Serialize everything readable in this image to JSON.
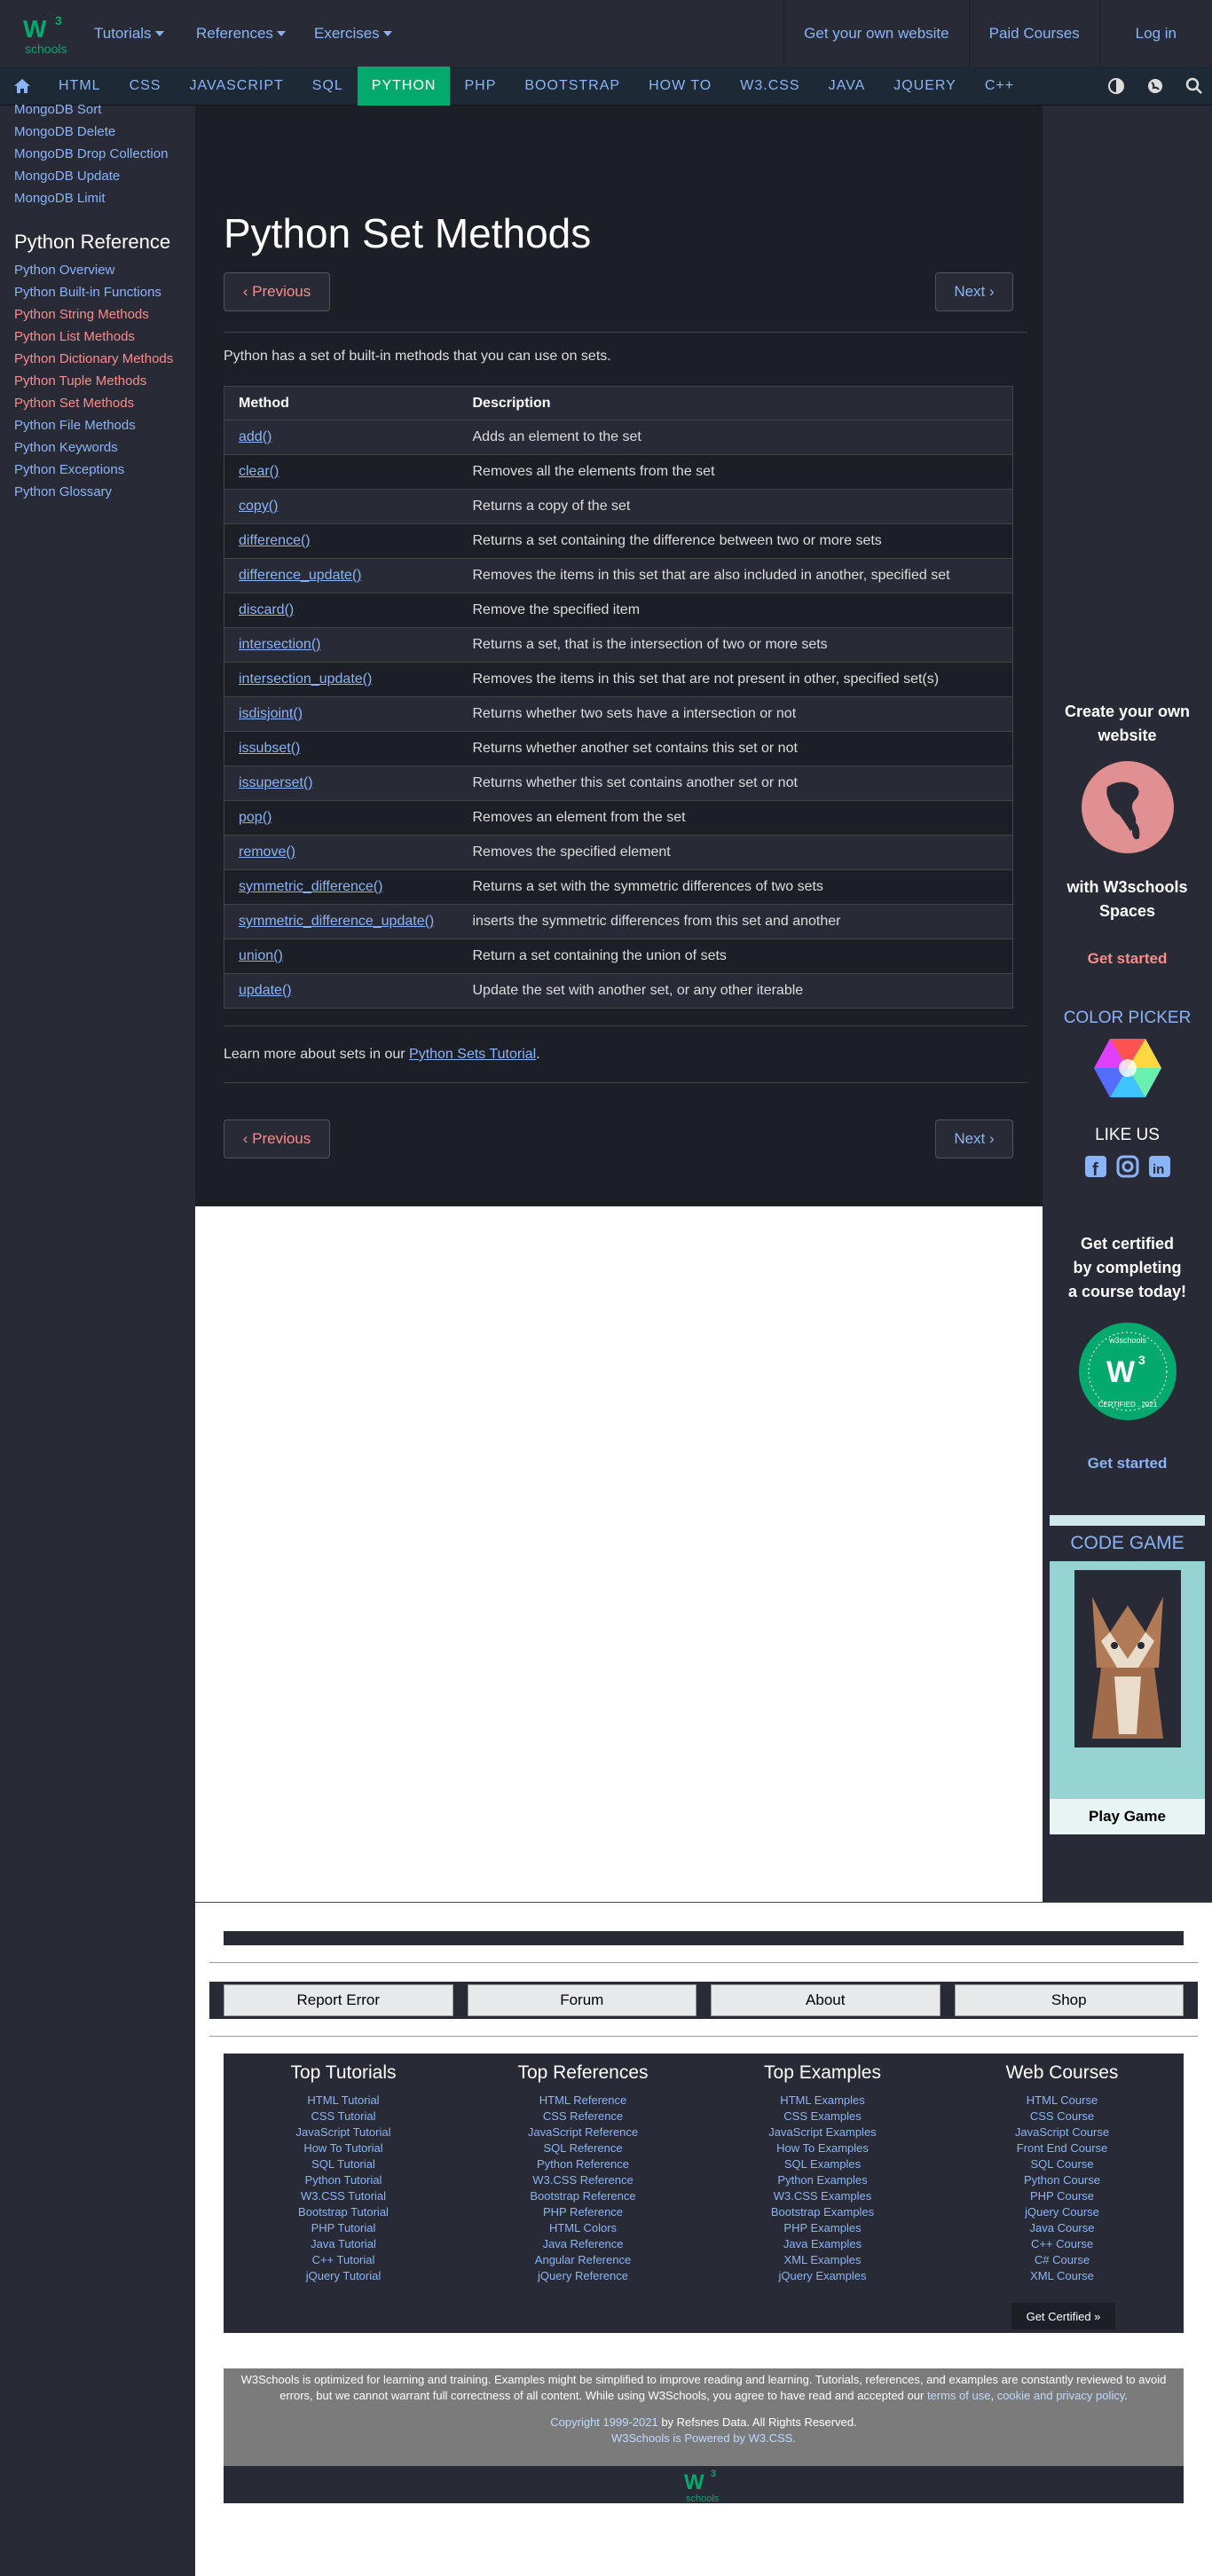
{
  "brand": {
    "name": "schools",
    "superscript": "3",
    "accent": "#04aa6d"
  },
  "topnav": {
    "tutorials": "Tutorials",
    "references": "References",
    "exercises": "Exercises"
  },
  "topright": {
    "website": "Get your own website",
    "courses": "Paid Courses",
    "login": "Log in"
  },
  "navbar": [
    "HTML",
    "CSS",
    "JAVASCRIPT",
    "SQL",
    "PYTHON",
    "PHP",
    "BOOTSTRAP",
    "HOW TO",
    "W3.CSS",
    "JAVA",
    "JQUERY",
    "C++"
  ],
  "sidebar": {
    "mongo": [
      "MongoDB Sort",
      "MongoDB Delete",
      "MongoDB Drop Collection",
      "MongoDB Update",
      "MongoDB Limit"
    ],
    "ref_title": "Python Reference",
    "refs": [
      {
        "label": "Python Overview",
        "color": "blue"
      },
      {
        "label": "Python Built-in Functions",
        "color": "blue"
      },
      {
        "label": "Python String Methods",
        "color": "red"
      },
      {
        "label": "Python List Methods",
        "color": "red"
      },
      {
        "label": "Python Dictionary Methods",
        "color": "red"
      },
      {
        "label": "Python Tuple Methods",
        "color": "red"
      },
      {
        "label": "Python Set Methods",
        "color": "red"
      },
      {
        "label": "Python File Methods",
        "color": "blue"
      },
      {
        "label": "Python Keywords",
        "color": "blue"
      },
      {
        "label": "Python Exceptions",
        "color": "blue"
      },
      {
        "label": "Python Glossary",
        "color": "blue"
      }
    ]
  },
  "main": {
    "title": "Python Set Methods",
    "prev": "Previous",
    "next": "Next",
    "intro": "Python has a set of built-in methods that you can use on sets.",
    "headers": [
      "Method",
      "Description"
    ],
    "rows": [
      [
        "add()",
        "Adds an element to the set"
      ],
      [
        "clear()",
        "Removes all the elements from the set"
      ],
      [
        "copy()",
        "Returns a copy of the set"
      ],
      [
        "difference()",
        "Returns a set containing the difference between two or more sets"
      ],
      [
        "difference_update()",
        "Removes the items in this set that are also included in another, specified set"
      ],
      [
        "discard()",
        "Remove the specified item"
      ],
      [
        "intersection()",
        "Returns a set, that is the intersection of two or more sets"
      ],
      [
        "intersection_update()",
        "Removes the items in this set that are not present in other, specified set(s)"
      ],
      [
        "isdisjoint()",
        "Returns whether two sets have a intersection or not"
      ],
      [
        "issubset()",
        "Returns whether another set contains this set or not"
      ],
      [
        "issuperset()",
        "Returns whether this set contains another set or not"
      ],
      [
        "pop()",
        "Removes an element from the set"
      ],
      [
        "remove()",
        "Removes the specified element"
      ],
      [
        "symmetric_difference()",
        "Returns a set with the symmetric differences of two sets"
      ],
      [
        "symmetric_difference_update()",
        "inserts the symmetric differences from this set and another"
      ],
      [
        "union()",
        "Return a set containing the union of sets"
      ],
      [
        "update()",
        "Update the set with another set, or any other iterable"
      ]
    ],
    "learn_prefix": "Learn more about sets in our ",
    "learn_link": "Python Sets Tutorial",
    "learn_suffix": "."
  },
  "rightbar": {
    "create_line1": "Create your own",
    "create_line2": "website",
    "with_line1": "with W3schools",
    "with_line2": "Spaces",
    "get_started": "Get started",
    "color_picker": "COLOR PICKER",
    "like_us": "LIKE US",
    "cert_line1": "Get certified",
    "cert_line2": "by completing",
    "cert_line3": "a course today!",
    "cert_get_started": "Get started",
    "code_game": "CODE GAME",
    "play_game": "Play Game",
    "badge_top": "w3schools",
    "badge_bottom": "CERTIFIED . 2021"
  },
  "footer": {
    "buttons": [
      "Report Error",
      "Forum",
      "About",
      "Shop"
    ],
    "cols": [
      {
        "title": "Top Tutorials",
        "items": [
          "HTML Tutorial",
          "CSS Tutorial",
          "JavaScript Tutorial",
          "How To Tutorial",
          "SQL Tutorial",
          "Python Tutorial",
          "W3.CSS Tutorial",
          "Bootstrap Tutorial",
          "PHP Tutorial",
          "Java Tutorial",
          "C++ Tutorial",
          "jQuery Tutorial"
        ]
      },
      {
        "title": "Top References",
        "items": [
          "HTML Reference",
          "CSS Reference",
          "JavaScript Reference",
          "SQL Reference",
          "Python Reference",
          "W3.CSS Reference",
          "Bootstrap Reference",
          "PHP Reference",
          "HTML Colors",
          "Java Reference",
          "Angular Reference",
          "jQuery Reference"
        ]
      },
      {
        "title": "Top Examples",
        "items": [
          "HTML Examples",
          "CSS Examples",
          "JavaScript Examples",
          "How To Examples",
          "SQL Examples",
          "Python Examples",
          "W3.CSS Examples",
          "Bootstrap Examples",
          "PHP Examples",
          "Java Examples",
          "XML Examples",
          "jQuery Examples"
        ]
      },
      {
        "title": "Web Courses",
        "items": [
          "HTML Course",
          "CSS Course",
          "JavaScript Course",
          "Front End Course",
          "SQL Course",
          "Python Course",
          "PHP Course",
          "jQuery Course",
          "Java Course",
          "C++ Course",
          "C# Course",
          "XML Course"
        ]
      }
    ],
    "certified_btn": "Get Certified »",
    "disclaimer_a": "W3Schools is optimized for learning and training. Examples might be simplified to improve reading and learning. Tutorials, references, and examples are constantly reviewed to avoid errors, but we cannot warrant full correctness of all content. While using W3Schools, you agree to have read and accepted our ",
    "terms": "terms of use",
    "comma": ", ",
    "privacy": "cookie and privacy policy",
    "period": ".",
    "copyright_link": "Copyright 1999-2021",
    "copyright_rest": " by Refsnes Data. All Rights Reserved.",
    "powered": "W3Schools is Powered by W3.CSS."
  }
}
